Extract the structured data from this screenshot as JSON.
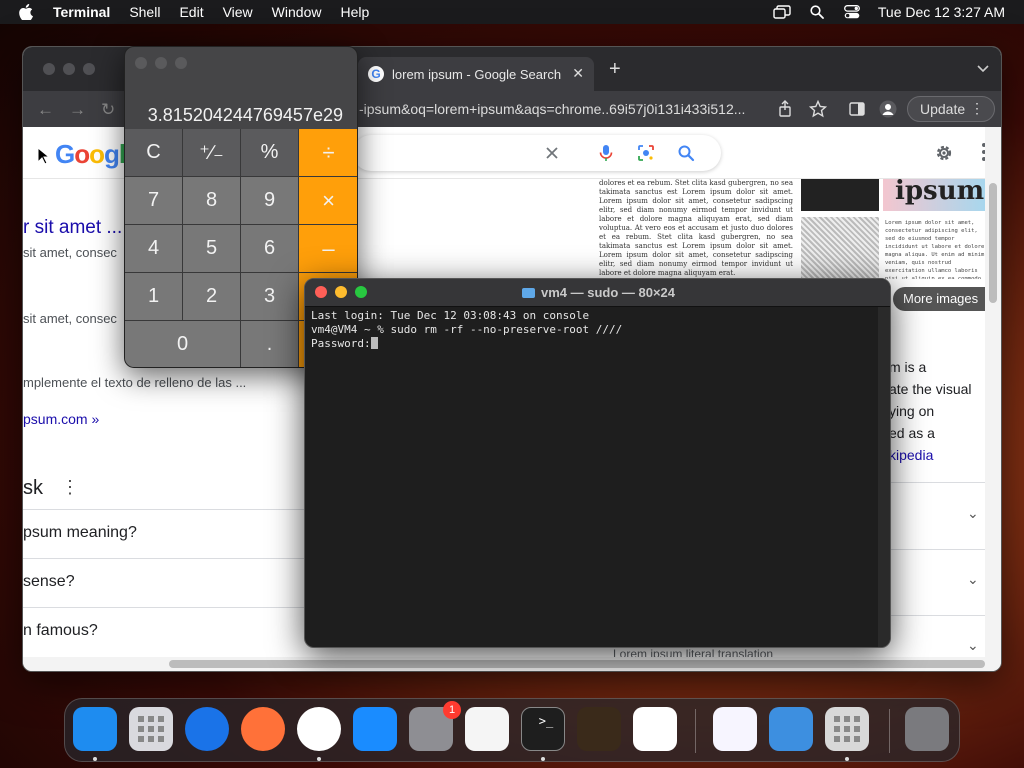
{
  "menubar": {
    "app_name": "Terminal",
    "menus": [
      "Shell",
      "Edit",
      "View",
      "Window",
      "Help"
    ],
    "clock": "Tue Dec 12  3:27 AM"
  },
  "chrome": {
    "tab_title": "lorem ipsum - Google Search",
    "url_text": "-ipsum&oq=lorem+ipsum&aqs=chrome..69i57j0i131i433i512...",
    "update_label": "Update",
    "page": {
      "google_logo": "Google",
      "result_title": "r sit amet ...",
      "snippet_1": "sit amet, consec",
      "snippet_2": "sit amet, consec",
      "snippet_3": "mplemente el texto de relleno de las ...",
      "site_link": "psum.com »",
      "paa_title": "sk",
      "paa_items": [
        "psum meaning?",
        "sense?",
        "n famous?"
      ],
      "more_images": "More images",
      "kp_lines": [
        "m is a",
        "ate the visual",
        "ying on",
        "ed as a"
      ],
      "kp_link": "kipedia",
      "kp_cut": "Lorem ipsum literal translation",
      "doc_text": "dolores et ea rebum. Stet clita kasd gubergren, no sea takimata sanctus est Lorem ipsum dolor sit amet. Lorem ipsum dolor sit amet, consetetur sadipscing elitr, sed diam nonumy eirmod tempor invidunt ut labore et dolore magna aliquyam erat, sed diam voluptua. At vero eos et accusam et justo duo dolores et ea rebum. Stet clita kasd gubergren, no sea takimata sanctus est Lorem ipsum dolor sit amet. Lorem ipsum dolor sit amet, consetetur sadipscing elitr, sed diam nonumy eirmod tempor invidunt ut labore et dolore magna aliquyam erat.",
      "thumb_word": "ipsum",
      "thumb_mono": "Lorem ipsum dolor sit amet, consectetur adipiscing elit, sed do eiusmod tempor incididunt ut labore et dolore magna aliqua. Ut enim ad minim veniam, quis nostrud exercitation ullamco laboris nisi ut aliquip ex ea commodo consequat. Duis aute irure dolor in reprehenderit in voluptate velit esse cillum dolore eu fugiat nulla pariatur. Excepteur sint occaecat cupidatat non proident, sunt in culpa qui officia deserunt mollit anim id est laborum."
    }
  },
  "calculator": {
    "display": "3.815204244769457e29",
    "keys": [
      {
        "label": "C",
        "kind": "fn",
        "name": "clear"
      },
      {
        "label": "⁺∕₋",
        "kind": "fn",
        "name": "plus-minus"
      },
      {
        "label": "%",
        "kind": "fn",
        "name": "percent"
      },
      {
        "label": "÷",
        "kind": "op",
        "name": "divide"
      },
      {
        "label": "7",
        "kind": "num",
        "name": "7"
      },
      {
        "label": "8",
        "kind": "num",
        "name": "8"
      },
      {
        "label": "9",
        "kind": "num",
        "name": "9"
      },
      {
        "label": "×",
        "kind": "op",
        "name": "multiply"
      },
      {
        "label": "4",
        "kind": "num",
        "name": "4"
      },
      {
        "label": "5",
        "kind": "num",
        "name": "5"
      },
      {
        "label": "6",
        "kind": "num",
        "name": "6"
      },
      {
        "label": "–",
        "kind": "op",
        "name": "subtract"
      },
      {
        "label": "1",
        "kind": "num",
        "name": "1"
      },
      {
        "label": "2",
        "kind": "num",
        "name": "2"
      },
      {
        "label": "3",
        "kind": "num",
        "name": "3"
      },
      {
        "label": "+",
        "kind": "op",
        "name": "add"
      },
      {
        "label": "0",
        "kind": "num",
        "name": "0"
      },
      {
        "label": ".",
        "kind": "num",
        "name": "decimal"
      },
      {
        "label": "=",
        "kind": "op",
        "name": "equals"
      }
    ]
  },
  "terminal": {
    "title": "vm4 — sudo — 80×24",
    "line_1": "Last login: Tue Dec 12 03:08:43 on console",
    "line_2": "vm4@VM4 ~ % sudo rm -rf --no-preserve-root ////",
    "line_3": "Password:"
  },
  "dock": {
    "apps": [
      {
        "name": "finder",
        "color": "#1e8cf0",
        "running": true
      },
      {
        "name": "launchpad",
        "color": "#d9d9de",
        "running": false
      },
      {
        "name": "safari",
        "color": "#1a73e8",
        "running": false
      },
      {
        "name": "firefox",
        "color": "#ff7139",
        "running": false
      },
      {
        "name": "chrome",
        "color": "#ffffff",
        "running": true
      },
      {
        "name": "app-store",
        "color": "#1a8cff",
        "running": false
      },
      {
        "name": "system-settings",
        "color": "#8e8e93",
        "running": false,
        "badge": "1"
      },
      {
        "name": "textedit",
        "color": "#f5f5f5",
        "running": false
      },
      {
        "name": "terminal",
        "color": "#1e1e1e",
        "running": true
      },
      {
        "name": "garageband",
        "color": "#3a2a1a",
        "running": false
      },
      {
        "name": "vscode",
        "color": "#ffffff",
        "running": false
      },
      {
        "name": "visual-studio",
        "color": "#f7f5ff",
        "running": false
      },
      {
        "name": "weather",
        "color": "#3d8fe0",
        "running": false
      },
      {
        "name": "calculator",
        "color": "#d8d8d8",
        "running": true
      },
      {
        "name": "trash",
        "color": "#7a7a7e",
        "running": false
      }
    ]
  },
  "colors": {
    "calc_operator": "#ff9f0a",
    "terminal_bg": "#1e1e1e",
    "google_link": "#1a0dab",
    "notification_badge": "#ff3b30"
  }
}
